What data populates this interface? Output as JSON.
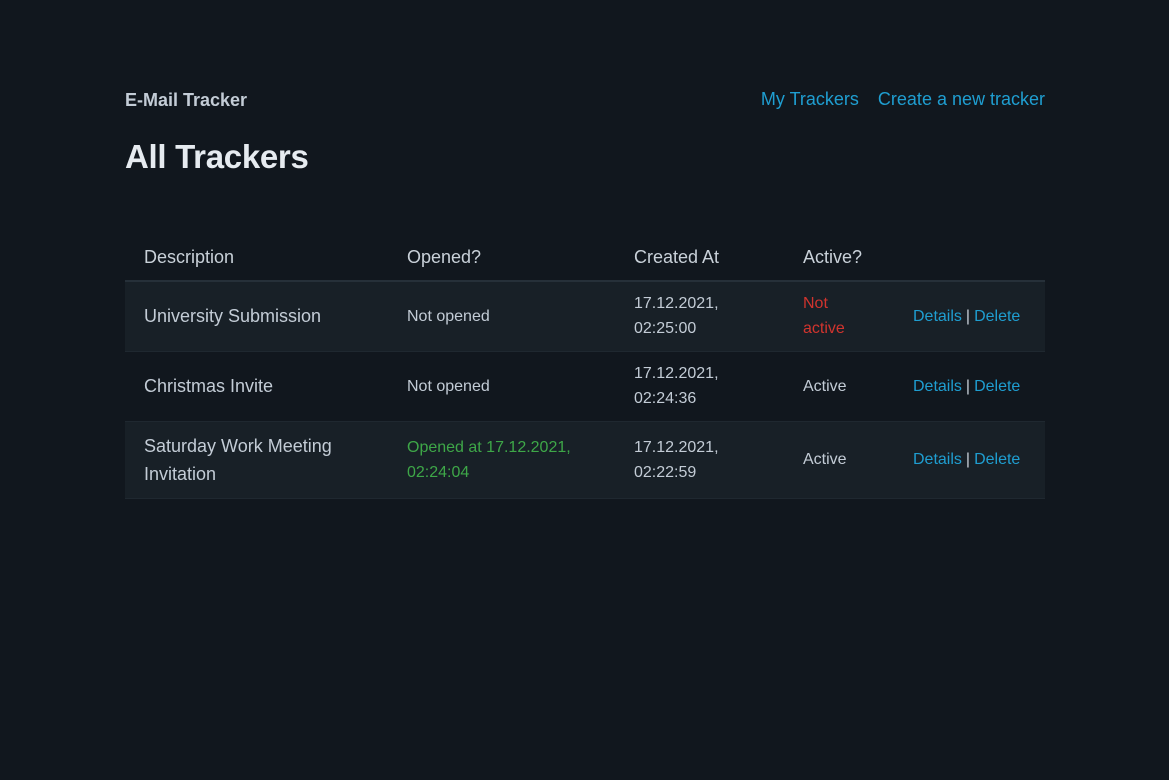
{
  "navbar": {
    "brand": "E-Mail Tracker",
    "links": [
      {
        "label": "My Trackers"
      },
      {
        "label": "Create a new tracker"
      }
    ]
  },
  "page": {
    "title": "All Trackers"
  },
  "table": {
    "headers": [
      "Description",
      "Opened?",
      "Created At",
      "Active?",
      ""
    ],
    "rows": [
      {
        "description": "University Submission",
        "opened": "Not opened",
        "opened_status": "no",
        "created_date": "17.12.2021,",
        "created_time": "02:25:00",
        "active_line1": "Not",
        "active_line2": "active",
        "active_status": "inactive",
        "details": "Details",
        "separator": "|",
        "delete": "Delete"
      },
      {
        "description": "Christmas Invite",
        "opened": "Not opened",
        "opened_status": "no",
        "created_date": "17.12.2021,",
        "created_time": "02:24:36",
        "active_line1": "Active",
        "active_line2": "",
        "active_status": "active",
        "details": "Details",
        "separator": "|",
        "delete": "Delete"
      },
      {
        "description_line1": "Saturday Work Meeting",
        "description_line2": "Invitation",
        "opened_line1": "Opened at 17.12.2021,",
        "opened_line2": "02:24:04",
        "opened_status": "yes",
        "created_date": "17.12.2021,",
        "created_time": "02:22:59",
        "active_line1": "Active",
        "active_line2": "",
        "active_status": "active",
        "details": "Details",
        "separator": "|",
        "delete": "Delete"
      }
    ]
  },
  "colors": {
    "background": "#11171e",
    "link": "#1f9ed1",
    "opened": "#3ea748",
    "inactive": "#d1342e"
  }
}
